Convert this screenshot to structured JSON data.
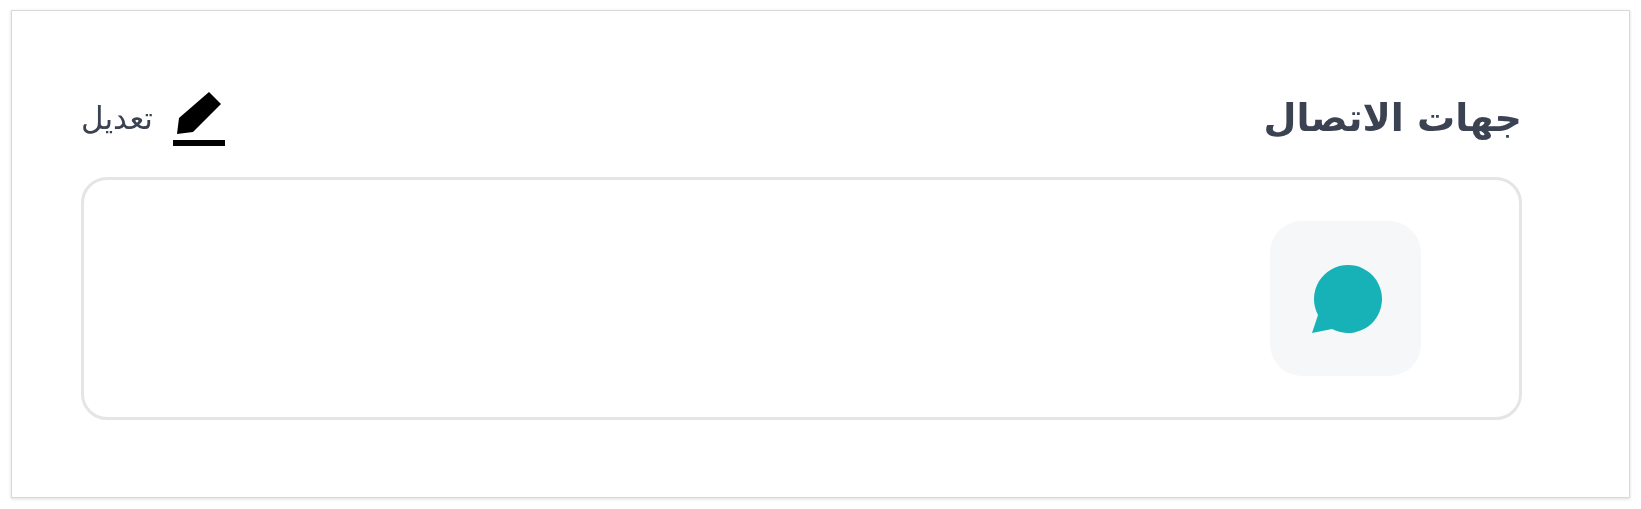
{
  "section": {
    "title": "جهات الاتصال",
    "edit_label": "تعديل"
  },
  "contacts": [
    {
      "kind": "chat"
    }
  ]
}
